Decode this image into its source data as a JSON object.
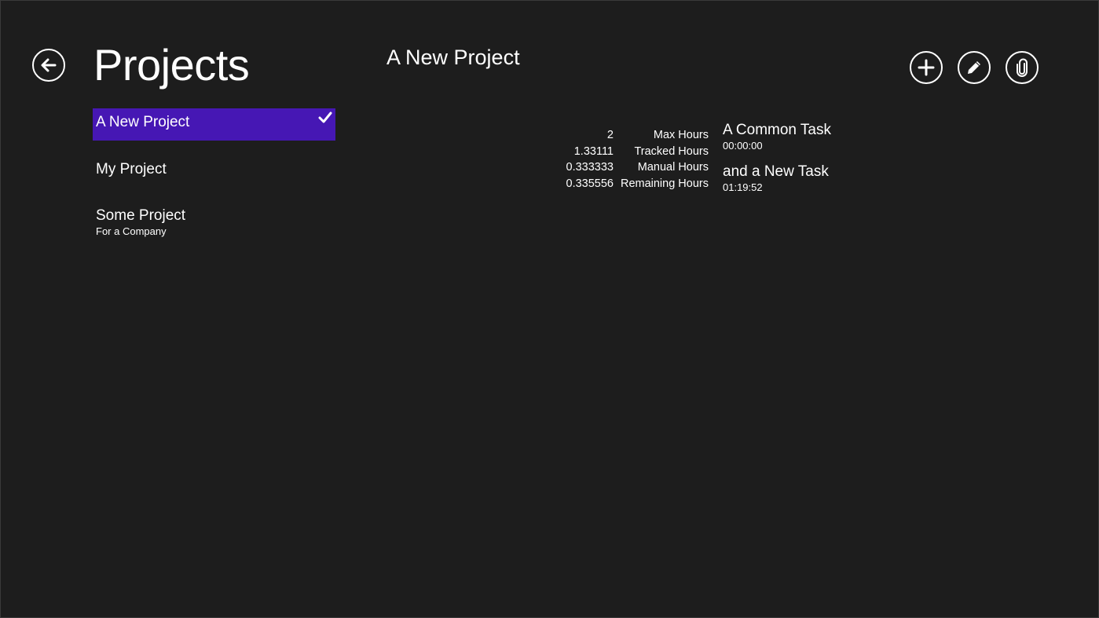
{
  "header": {
    "page_title": "Projects",
    "detail_title": "A New Project"
  },
  "projects": [
    {
      "name": "A New Project",
      "subtitle": "",
      "selected": true
    },
    {
      "name": "My Project",
      "subtitle": "",
      "selected": false
    },
    {
      "name": "Some Project",
      "subtitle": "For a Company",
      "selected": false
    }
  ],
  "stats": [
    {
      "value": "2",
      "label": "Max Hours"
    },
    {
      "value": "1.33111",
      "label": "Tracked Hours"
    },
    {
      "value": "0.333333",
      "label": "Manual Hours"
    },
    {
      "value": "0.335556",
      "label": "Remaining Hours"
    }
  ],
  "tasks": [
    {
      "name": "A Common Task",
      "time": "00:00:00"
    },
    {
      "name": "and a New Task",
      "time": "01:19:52"
    }
  ],
  "icons": {
    "back": "back-arrow-icon",
    "add": "plus-icon",
    "edit": "pencil-icon",
    "attach": "paperclip-icon",
    "selected": "checkmark-icon"
  },
  "colors": {
    "background": "#1d1d1d",
    "accent": "#4617b4",
    "text": "#ffffff"
  }
}
